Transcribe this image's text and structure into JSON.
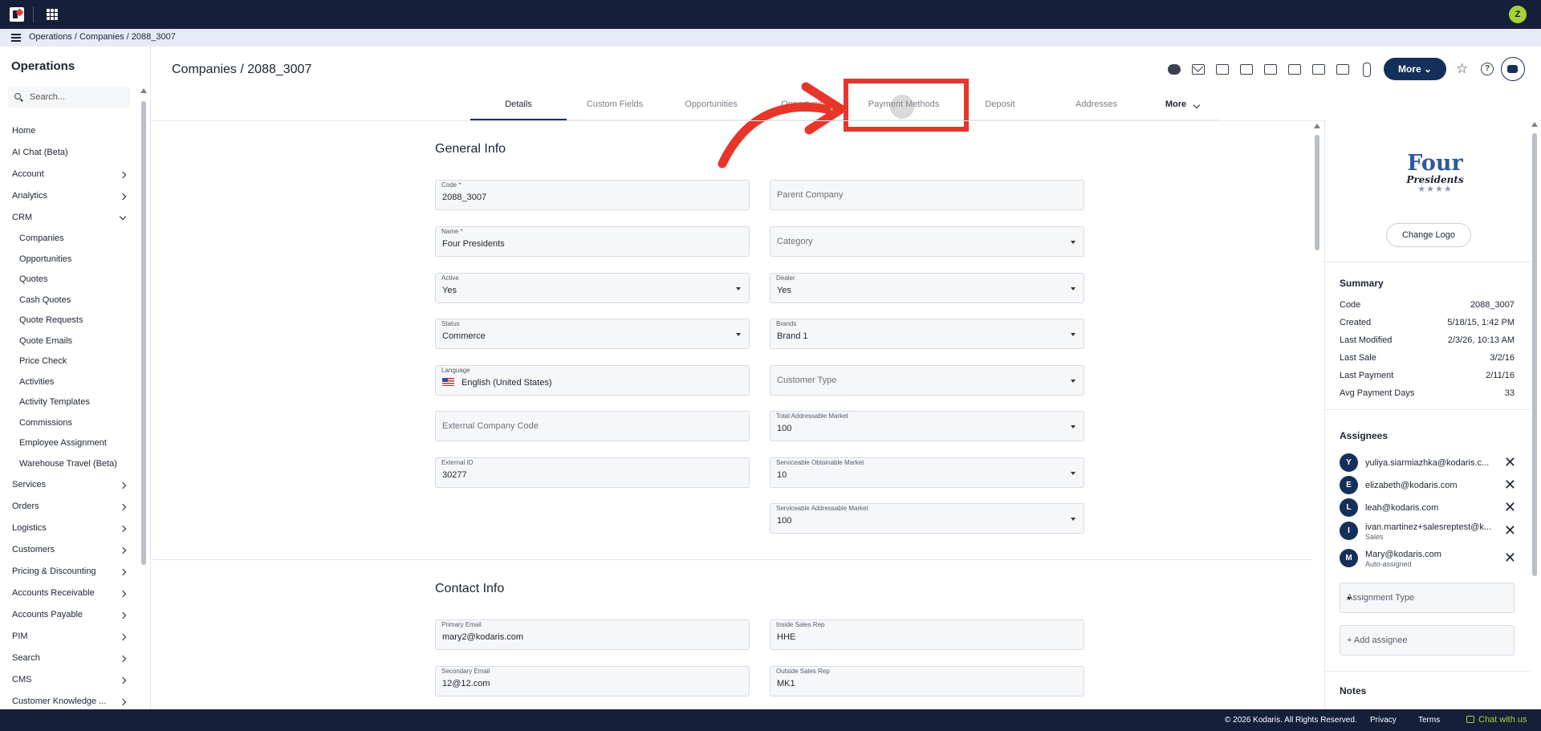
{
  "breadcrumb": "Operations / Companies / 2088_3007",
  "sidebar": {
    "title": "Operations",
    "search_placeholder": "Search...",
    "items": [
      {
        "label": "Home",
        "type": "top",
        "chevron": ""
      },
      {
        "label": "AI Chat (Beta)",
        "type": "top",
        "chevron": ""
      },
      {
        "label": "Account",
        "type": "top",
        "chevron": "right"
      },
      {
        "label": "Analytics",
        "type": "top",
        "chevron": "right"
      },
      {
        "label": "CRM",
        "type": "top",
        "chevron": "down"
      },
      {
        "label": "Companies",
        "type": "sub",
        "chevron": ""
      },
      {
        "label": "Opportunities",
        "type": "sub",
        "chevron": ""
      },
      {
        "label": "Quotes",
        "type": "sub",
        "chevron": ""
      },
      {
        "label": "Cash Quotes",
        "type": "sub",
        "chevron": ""
      },
      {
        "label": "Quote Requests",
        "type": "sub",
        "chevron": ""
      },
      {
        "label": "Quote Emails",
        "type": "sub",
        "chevron": ""
      },
      {
        "label": "Price Check",
        "type": "sub",
        "chevron": ""
      },
      {
        "label": "Activities",
        "type": "sub",
        "chevron": ""
      },
      {
        "label": "Activity Templates",
        "type": "sub",
        "chevron": ""
      },
      {
        "label": "Commissions",
        "type": "sub",
        "chevron": ""
      },
      {
        "label": "Employee Assignment",
        "type": "sub",
        "chevron": ""
      },
      {
        "label": "Warehouse Travel (Beta)",
        "type": "sub",
        "chevron": ""
      },
      {
        "label": "Services",
        "type": "top",
        "chevron": "right"
      },
      {
        "label": "Orders",
        "type": "top",
        "chevron": "right"
      },
      {
        "label": "Logistics",
        "type": "top",
        "chevron": "right"
      },
      {
        "label": "Customers",
        "type": "top",
        "chevron": "right"
      },
      {
        "label": "Pricing & Discounting",
        "type": "top",
        "chevron": "right"
      },
      {
        "label": "Accounts Receivable",
        "type": "top",
        "chevron": "right"
      },
      {
        "label": "Accounts Payable",
        "type": "top",
        "chevron": "right"
      },
      {
        "label": "PIM",
        "type": "top",
        "chevron": "right"
      },
      {
        "label": "Search",
        "type": "top",
        "chevron": "right"
      },
      {
        "label": "CMS",
        "type": "top",
        "chevron": "right"
      },
      {
        "label": "Customer Knowledge ...",
        "type": "top",
        "chevron": "right"
      }
    ]
  },
  "header": {
    "title": "Companies / 2088_3007",
    "more_label": "More",
    "user_initial": "Z",
    "help_glyph": "?",
    "star_glyph": "☆"
  },
  "tabs": [
    {
      "label": "Details",
      "active": true
    },
    {
      "label": "Custom Fields",
      "active": false
    },
    {
      "label": "Opportunities",
      "active": false
    },
    {
      "label": "Opportunities",
      "active": false
    },
    {
      "label": "Payment Methods",
      "active": false
    },
    {
      "label": "Deposit",
      "active": false
    },
    {
      "label": "Addresses",
      "active": false
    },
    {
      "label": "More",
      "active": false
    }
  ],
  "general_info": {
    "title": "General Info",
    "code": {
      "label": "Code *",
      "value": "2088_3007"
    },
    "parent_company": {
      "placeholder": "Parent Company"
    },
    "name": {
      "label": "Name *",
      "value": "Four Presidents"
    },
    "category": {
      "placeholder": "Category"
    },
    "active": {
      "label": "Active",
      "value": "Yes"
    },
    "dealer": {
      "label": "Dealer",
      "value": "Yes"
    },
    "status": {
      "label": "Status",
      "value": "Commerce"
    },
    "brands": {
      "label": "Brands",
      "value": "Brand 1"
    },
    "language": {
      "label": "Language",
      "value": "English (United States)"
    },
    "customer_type": {
      "placeholder": "Customer Type"
    },
    "external_company_code": {
      "placeholder": "External Company Code"
    },
    "tam": {
      "label": "Total Addressable Market",
      "value": "100"
    },
    "external_id": {
      "label": "External ID",
      "value": "30277"
    },
    "som": {
      "label": "Serviceable Obtainable Market",
      "value": "10"
    },
    "sam": {
      "label": "Serviceable Addressable Market",
      "value": "100"
    }
  },
  "contact_info": {
    "title": "Contact Info",
    "primary_email": {
      "label": "Primary Email",
      "value": "mary2@kodaris.com"
    },
    "inside_sales_rep": {
      "label": "Inside Sales Rep",
      "value": "HHE"
    },
    "secondary_email": {
      "label": "Secondary Email",
      "value": "12@12.com"
    },
    "outside_sales_rep": {
      "label": "Outside Sales Rep",
      "value": "MK1"
    }
  },
  "right_panel": {
    "logo_line1": "Four",
    "logo_line2": "Presidents",
    "logo_stars": "★★★★",
    "change_logo": "Change Logo",
    "summary_title": "Summary",
    "summary": [
      {
        "key": "Code",
        "value": "2088_3007"
      },
      {
        "key": "Created",
        "value": "5/18/15, 1:42 PM"
      },
      {
        "key": "Last Modified",
        "value": "2/3/26, 10:13 AM"
      },
      {
        "key": "Last Sale",
        "value": "3/2/16"
      },
      {
        "key": "Last Payment",
        "value": "2/11/16"
      },
      {
        "key": "Avg Payment Days",
        "value": "33"
      }
    ],
    "assignees_title": "Assignees",
    "assignees": [
      {
        "initial": "Y",
        "email": "yuliya.siarmiazhka@kodaris.c...",
        "role": ""
      },
      {
        "initial": "E",
        "email": "elizabeth@kodaris.com",
        "role": ""
      },
      {
        "initial": "L",
        "email": "leah@kodaris.com",
        "role": ""
      },
      {
        "initial": "I",
        "email": "ivan.martinez+salesreptest@k...",
        "role": "Sales"
      },
      {
        "initial": "M",
        "email": "Mary@kodaris.com",
        "role": "Auto-assigned"
      }
    ],
    "assignment_type_placeholder": "Assignment Type",
    "add_assignee": "+ Add assignee",
    "notes_title": "Notes"
  },
  "footer": {
    "copyright": "© 2026 Kodaris. All Rights Reserved.",
    "privacy": "Privacy",
    "terms": "Terms",
    "chat": "Chat with us"
  },
  "colors": {
    "navbar": "#14203a",
    "primary_button": "#14305a",
    "annotation_red": "#e8352a",
    "accent_green": "#a6d233"
  }
}
